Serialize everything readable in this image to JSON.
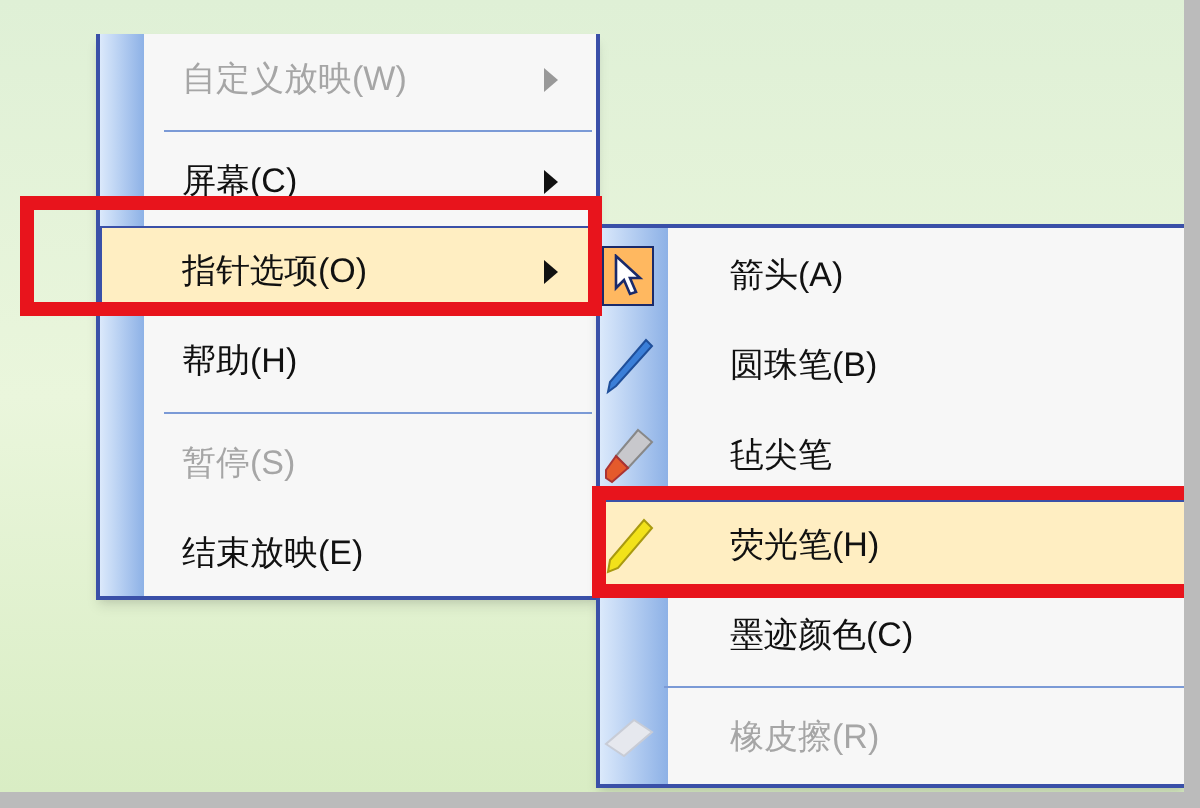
{
  "menu": {
    "items": [
      {
        "kind": "plain",
        "label": "自定义放映(W)",
        "disabled": true,
        "submenu": true,
        "selected": false
      },
      {
        "kind": "separator"
      },
      {
        "kind": "plain",
        "label": "屏幕(C)",
        "disabled": false,
        "submenu": true,
        "selected": false
      },
      {
        "kind": "plain",
        "label": "指针选项(O)",
        "disabled": false,
        "submenu": true,
        "selected": true
      },
      {
        "kind": "plain",
        "label": "帮助(H)",
        "disabled": false,
        "submenu": false,
        "selected": false
      },
      {
        "kind": "separator"
      },
      {
        "kind": "plain",
        "label": "暂停(S)",
        "disabled": true,
        "submenu": false,
        "selected": false
      },
      {
        "kind": "plain",
        "label": "结束放映(E)",
        "disabled": false,
        "submenu": false,
        "selected": false
      }
    ]
  },
  "submenu": {
    "items": [
      {
        "kind": "pointer",
        "label": "箭头(A)",
        "disabled": false,
        "checked": true,
        "selected": false
      },
      {
        "kind": "ballpoint",
        "label": "圆珠笔(B)",
        "disabled": false,
        "checked": false,
        "selected": false
      },
      {
        "kind": "felt-tip",
        "label": "毡尖笔",
        "disabled": false,
        "checked": false,
        "selected": false
      },
      {
        "kind": "highlighter",
        "label": "荧光笔(H)",
        "disabled": false,
        "checked": false,
        "selected": true
      },
      {
        "kind": "plain",
        "label": "墨迹颜色(C)",
        "disabled": false,
        "checked": false,
        "selected": false
      },
      {
        "kind": "separator"
      },
      {
        "kind": "eraser",
        "label": "橡皮擦(R)",
        "disabled": true,
        "checked": false,
        "selected": false
      }
    ]
  }
}
